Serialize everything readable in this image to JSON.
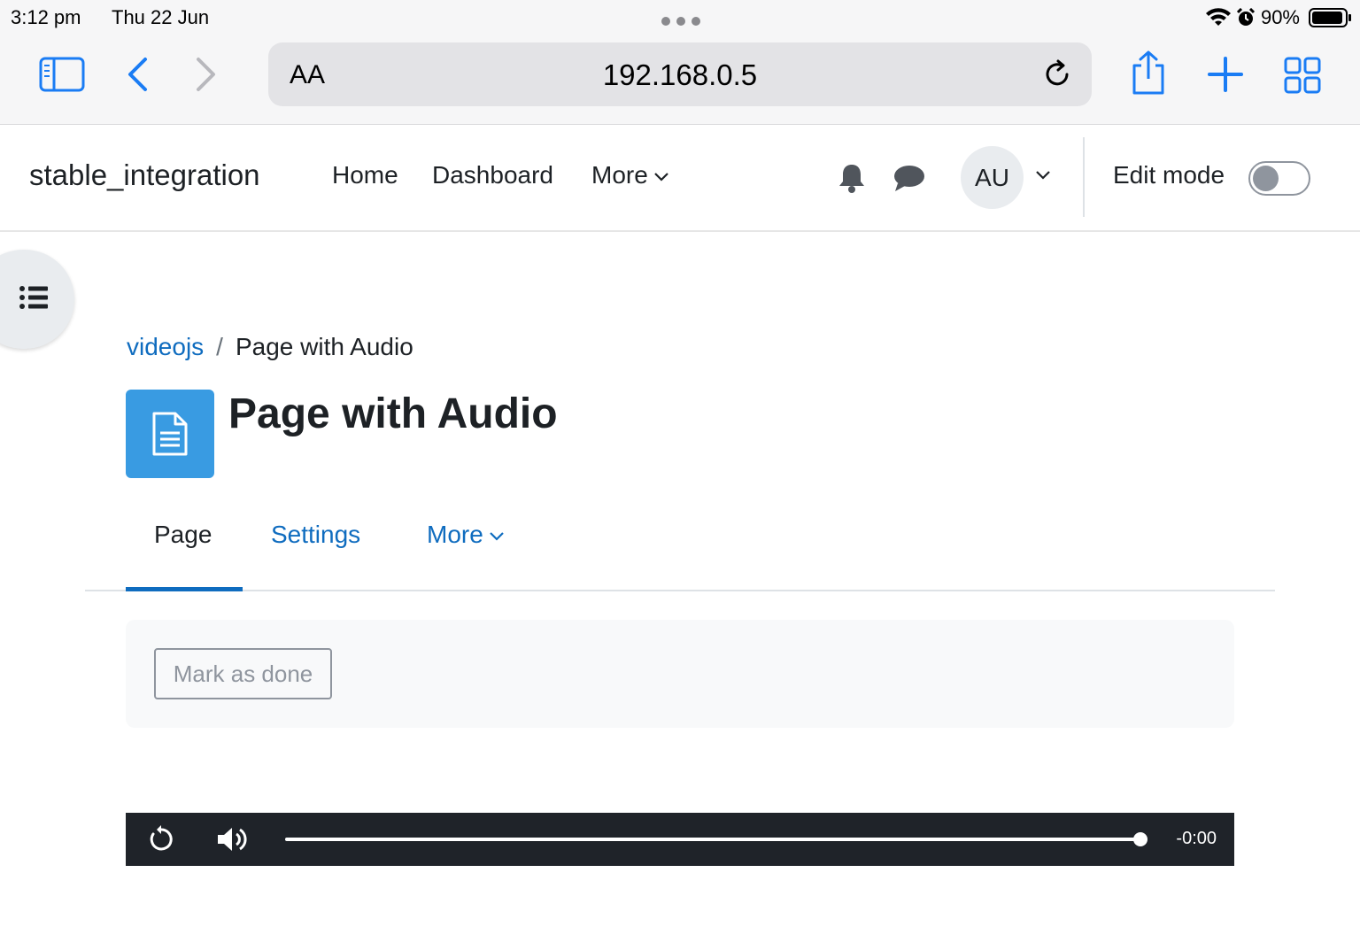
{
  "status_bar": {
    "time": "3:12 pm",
    "date": "Thu 22 Jun",
    "battery": "90%"
  },
  "browser": {
    "text_size_label": "AA",
    "url": "192.168.0.5",
    "icons": [
      "sidebar-icon",
      "back-icon",
      "forward-icon",
      "reload-icon",
      "share-icon",
      "new-tab-icon",
      "tabs-overview-icon"
    ]
  },
  "navbar": {
    "site_name": "stable_integration",
    "links": [
      "Home",
      "Dashboard",
      "More"
    ],
    "avatar_initials": "AU",
    "edit_mode_label": "Edit mode",
    "edit_mode_on": false
  },
  "breadcrumb": {
    "parent": "videojs",
    "separator": "/",
    "current": "Page with Audio"
  },
  "page": {
    "title": "Page with Audio",
    "icon": "page-icon"
  },
  "secondary_nav": {
    "tabs": [
      "Page",
      "Settings",
      "More"
    ],
    "active": "Page"
  },
  "activity": {
    "mark_done_label": "Mark as done"
  },
  "player": {
    "remaining_time": "-0:00",
    "progress": 1.0
  },
  "colors": {
    "link": "#0f6cbf",
    "page_icon_bg": "#399be2",
    "player_bg": "#1f2329",
    "ios_blue": "#1a7cf4"
  }
}
